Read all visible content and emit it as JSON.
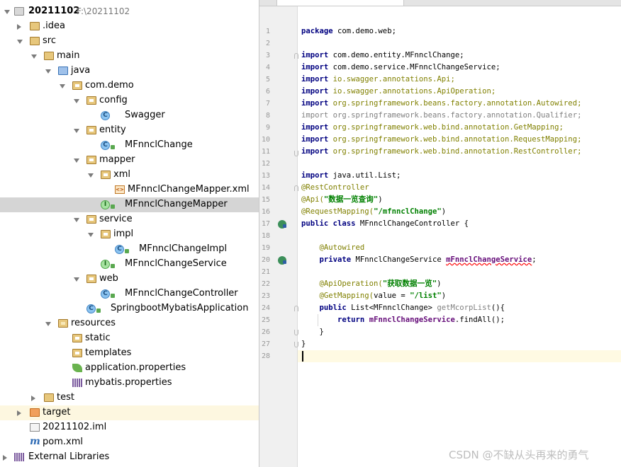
{
  "project_tree": {
    "root": {
      "name": "20211102",
      "path": "F:\\20211102"
    },
    "items": [
      {
        "label": ".idea"
      },
      {
        "label": "src"
      },
      {
        "label": "main"
      },
      {
        "label": "java"
      },
      {
        "label": "com.demo"
      },
      {
        "label": "config"
      },
      {
        "label": "Swagger"
      },
      {
        "label": "entity"
      },
      {
        "label": "MFnnclChange"
      },
      {
        "label": "mapper"
      },
      {
        "label": "xml"
      },
      {
        "label": "MFnnclChangeMapper.xml"
      },
      {
        "label": "MFnnclChangeMapper"
      },
      {
        "label": "service"
      },
      {
        "label": "impl"
      },
      {
        "label": "MFnnclChangeImpl"
      },
      {
        "label": "MFnnclChangeService"
      },
      {
        "label": "web"
      },
      {
        "label": "MFnnclChangeController"
      },
      {
        "label": "SpringbootMybatisApplication"
      },
      {
        "label": "resources"
      },
      {
        "label": "static"
      },
      {
        "label": "templates"
      },
      {
        "label": "application.properties"
      },
      {
        "label": "mybatis.properties"
      },
      {
        "label": "test"
      },
      {
        "label": "target"
      },
      {
        "label": "20211102.iml"
      },
      {
        "label": "pom.xml"
      },
      {
        "label": "External Libraries"
      }
    ],
    "selected": "MFnnclChangeMapper"
  },
  "editor": {
    "line_numbers": [
      "1",
      "2",
      "3",
      "4",
      "5",
      "6",
      "7",
      "8",
      "9",
      "10",
      "11",
      "12",
      "13",
      "14",
      "15",
      "16",
      "17",
      "18",
      "19",
      "20",
      "21",
      "22",
      "23",
      "24",
      "25",
      "26",
      "27",
      "28"
    ],
    "lines": [
      [
        {
          "t": "package ",
          "c": "kw"
        },
        {
          "t": "com.demo.web;",
          "c": ""
        }
      ],
      [],
      [
        {
          "t": "import ",
          "c": "kw"
        },
        {
          "t": "com.demo.entity.MFnnclChange;",
          "c": ""
        }
      ],
      [
        {
          "t": "import ",
          "c": "kw"
        },
        {
          "t": "com.demo.service.MFnnclChangeService;",
          "c": ""
        }
      ],
      [
        {
          "t": "import ",
          "c": "kw"
        },
        {
          "t": "io.swagger.annotations.Api;",
          "c": "grn"
        }
      ],
      [
        {
          "t": "import ",
          "c": "kw"
        },
        {
          "t": "io.swagger.annotations.ApiOperation;",
          "c": "grn"
        }
      ],
      [
        {
          "t": "import ",
          "c": "kw"
        },
        {
          "t": "org.springframework.beans.factory.annotation.Autowired;",
          "c": "grn"
        }
      ],
      [
        {
          "t": "import ",
          "c": "gray"
        },
        {
          "t": "org.springframework.beans.factory.annotation.Qualifier;",
          "c": "gray"
        }
      ],
      [
        {
          "t": "import ",
          "c": "kw"
        },
        {
          "t": "org.springframework.web.bind.annotation.GetMapping;",
          "c": "grn"
        }
      ],
      [
        {
          "t": "import ",
          "c": "kw"
        },
        {
          "t": "org.springframework.web.bind.annotation.RequestMapping;",
          "c": "grn"
        }
      ],
      [
        {
          "t": "import ",
          "c": "kw"
        },
        {
          "t": "org.springframework.web.bind.annotation.RestController;",
          "c": "grn"
        }
      ],
      [],
      [
        {
          "t": "import ",
          "c": "kw"
        },
        {
          "t": "java.util.List;",
          "c": ""
        }
      ],
      [
        {
          "t": "@RestController",
          "c": "ann"
        }
      ],
      [
        {
          "t": "@Api(",
          "c": "ann"
        },
        {
          "t": "\"数据一览查询\"",
          "c": "str"
        },
        {
          "t": ")",
          "c": ""
        }
      ],
      [
        {
          "t": "@RequestMapping(",
          "c": "ann"
        },
        {
          "t": "\"/mfnnclChange\"",
          "c": "str"
        },
        {
          "t": ")",
          "c": ""
        }
      ],
      [
        {
          "t": "public class ",
          "c": "kw"
        },
        {
          "t": "MFnnclChangeController {",
          "c": ""
        }
      ],
      [],
      [
        {
          "t": "    ",
          "c": ""
        },
        {
          "t": "@Autowired",
          "c": "ann"
        }
      ],
      [
        {
          "t": "    ",
          "c": ""
        },
        {
          "t": "private ",
          "c": "kw"
        },
        {
          "t": "MFnnclChangeService ",
          "c": ""
        },
        {
          "t": "mFnnclChangeService",
          "c": "fld squig"
        },
        {
          "t": ";",
          "c": ""
        }
      ],
      [],
      [
        {
          "t": "    ",
          "c": ""
        },
        {
          "t": "@ApiOperation(",
          "c": "ann"
        },
        {
          "t": "\"获取数据一览\"",
          "c": "str"
        },
        {
          "t": ")",
          "c": ""
        }
      ],
      [
        {
          "t": "    ",
          "c": ""
        },
        {
          "t": "@GetMapping(",
          "c": "ann"
        },
        {
          "t": "value = ",
          "c": ""
        },
        {
          "t": "\"/list\"",
          "c": "str"
        },
        {
          "t": ")",
          "c": ""
        }
      ],
      [
        {
          "t": "    ",
          "c": ""
        },
        {
          "t": "public ",
          "c": "kw"
        },
        {
          "t": "List<MFnnclChange> ",
          "c": ""
        },
        {
          "t": "getMcorpList",
          "c": "gray"
        },
        {
          "t": "(){",
          "c": ""
        }
      ],
      [
        {
          "t": "        ",
          "c": ""
        },
        {
          "t": "return ",
          "c": "kw"
        },
        {
          "t": "mFnnclChangeService",
          "c": "fld"
        },
        {
          "t": ".findAll();",
          "c": ""
        }
      ],
      [
        {
          "t": "    }",
          "c": ""
        }
      ],
      [
        {
          "t": "}",
          "c": ""
        }
      ],
      []
    ]
  },
  "watermark": "CSDN @不缺从头再来的勇气"
}
